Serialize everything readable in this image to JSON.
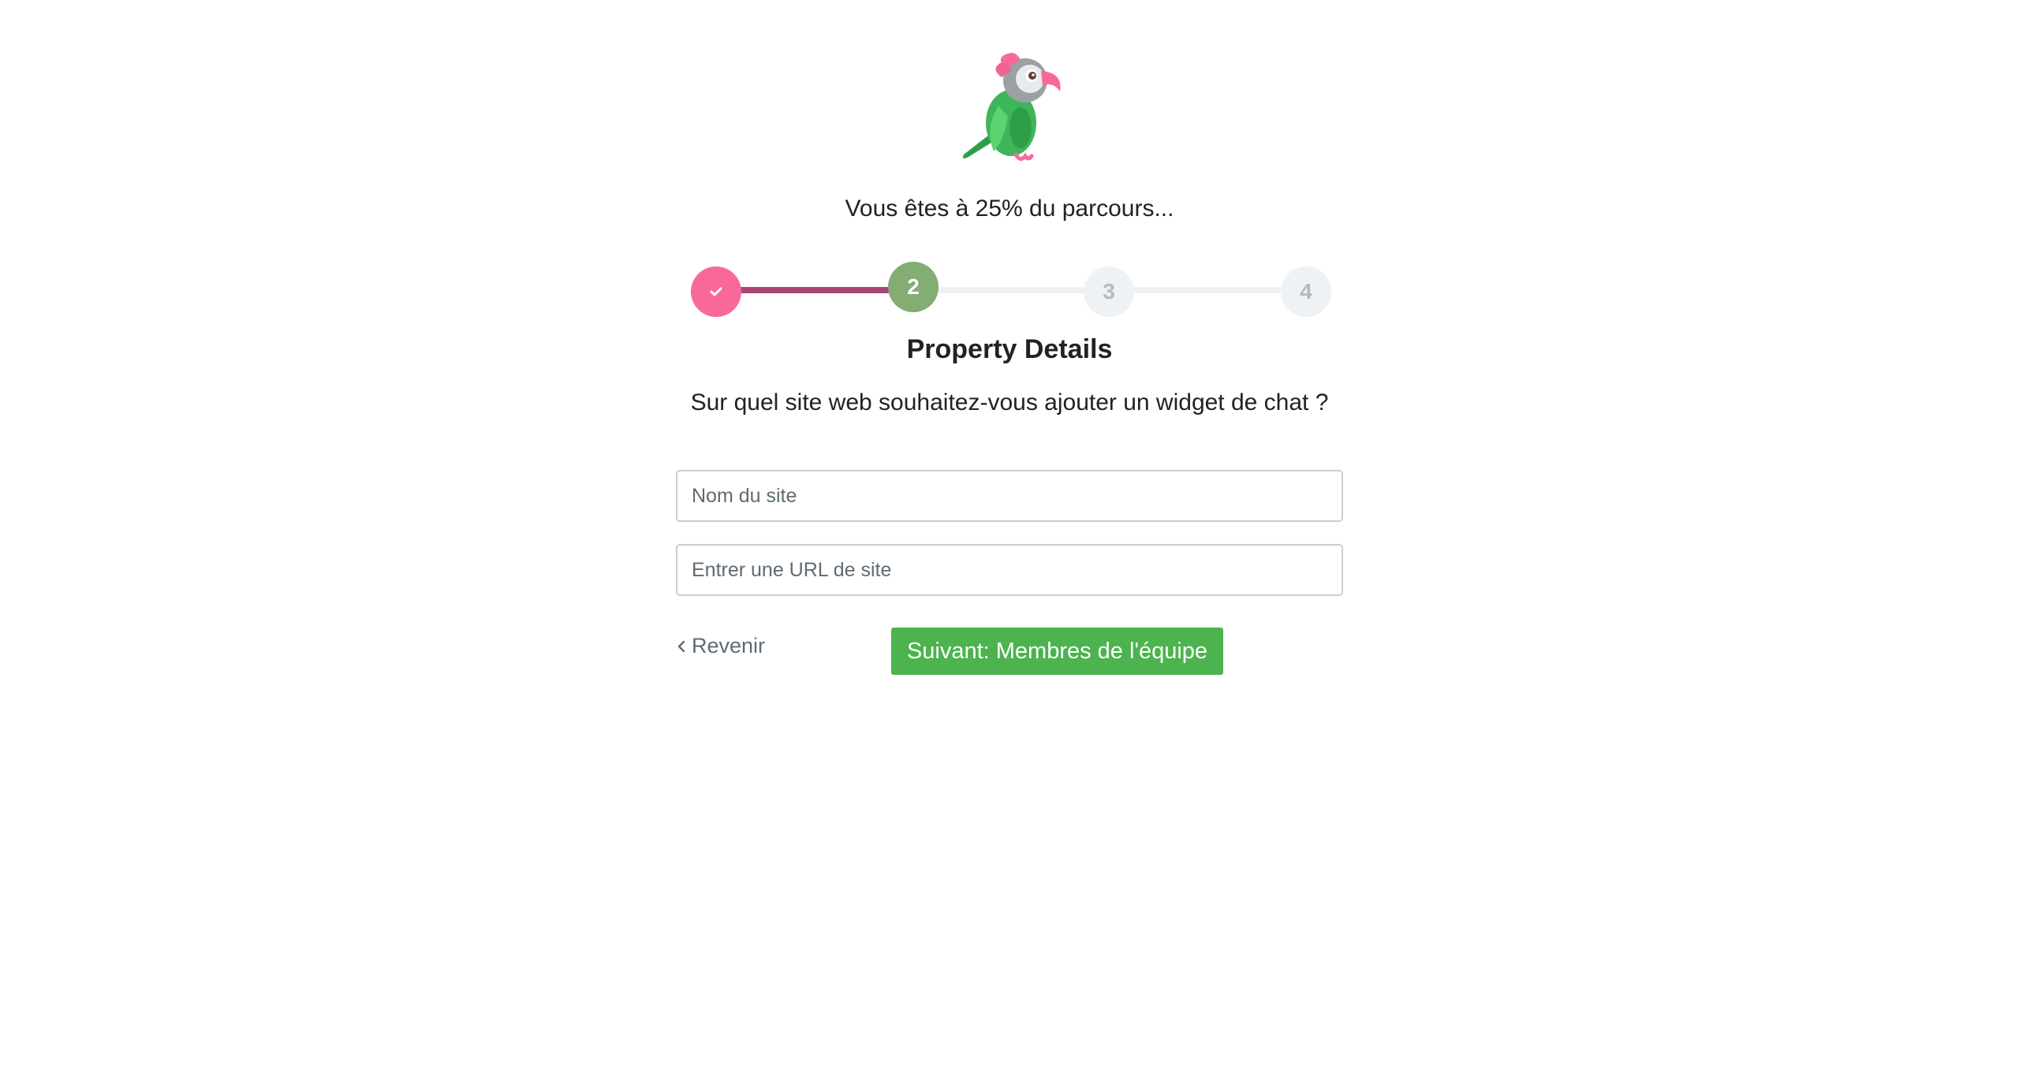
{
  "header": {
    "logo_icon": "parrot-mascot-icon",
    "progress_text": "Vous êtes à 25% du parcours..."
  },
  "stepper": {
    "progress_percent": 25,
    "steps": [
      {
        "label": "",
        "state": "completed",
        "icon": "check-icon"
      },
      {
        "label": "2",
        "state": "current"
      },
      {
        "label": "3",
        "state": "upcoming"
      },
      {
        "label": "4",
        "state": "upcoming"
      }
    ]
  },
  "section": {
    "title": "Property Details",
    "question": "Sur quel site web souhaitez-vous ajouter un widget de chat ?"
  },
  "form": {
    "site_name_placeholder": "Nom du site",
    "site_url_placeholder": "Entrer une URL de site"
  },
  "actions": {
    "back_label": "Revenir",
    "back_icon": "chevron-left-icon",
    "next_label": "Suivant: Membres de l'équipe"
  },
  "colors": {
    "completed_step": "#f8699a",
    "completed_line": "#a84677",
    "current_step": "#83ad73",
    "upcoming_step": "#eef2f5",
    "primary_button": "#4cb34e"
  }
}
